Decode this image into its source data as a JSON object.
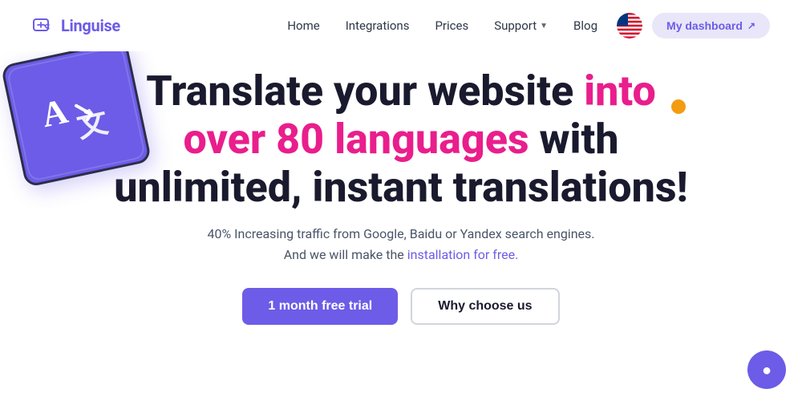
{
  "brand": {
    "name": "Linguise",
    "logo_alt": "linguise-logo"
  },
  "navbar": {
    "links": [
      {
        "label": "Home",
        "has_dropdown": false
      },
      {
        "label": "Integrations",
        "has_dropdown": false
      },
      {
        "label": "Prices",
        "has_dropdown": false
      },
      {
        "label": "Support",
        "has_dropdown": true
      },
      {
        "label": "Blog",
        "has_dropdown": false
      }
    ],
    "dashboard_btn": "My dashboard",
    "flag_alt": "US flag"
  },
  "hero": {
    "title_part1": "Translate your website ",
    "title_highlight": "into over 80 languages",
    "title_part2": " with unlimited, instant translations!",
    "subtitle_line1": "40% Increasing traffic from Google, Baidu or Yandex search engines.",
    "subtitle_line2": "And we will make the ",
    "subtitle_link": "installation for free.",
    "btn_primary": "1 month free trial",
    "btn_secondary": "Why choose us"
  },
  "colors": {
    "brand_purple": "#6c5ce7",
    "highlight_pink": "#e91e8c",
    "orange_dot": "#f39c12",
    "dark_text": "#1a1a2e"
  },
  "chat": {
    "icon": "💬"
  }
}
